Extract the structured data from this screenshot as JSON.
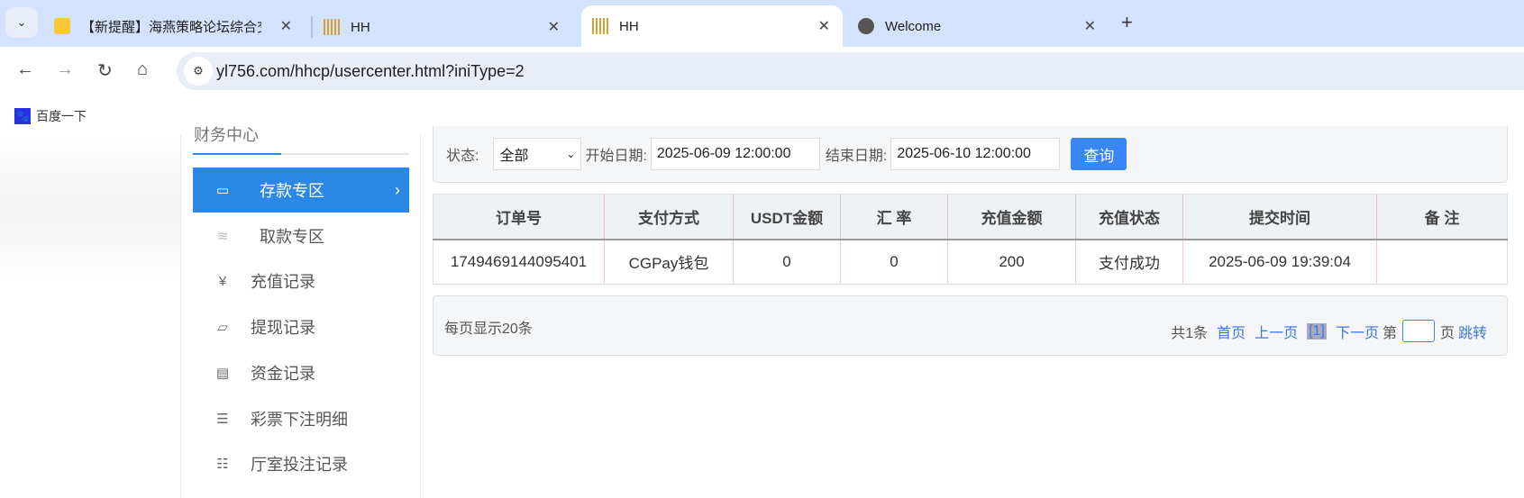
{
  "browser": {
    "tabs": [
      {
        "title": "【新提醒】海燕策略论坛综合交",
        "icon": "notification-icon",
        "active": false
      },
      {
        "title": "HH",
        "icon": "hh-logo-icon",
        "active": false
      },
      {
        "title": "HH",
        "icon": "hh-logo-icon",
        "active": true
      },
      {
        "title": "Welcome",
        "icon": "globe-icon",
        "active": false
      }
    ],
    "url": "yl756.com/hhcp/usercenter.html?iniType=2",
    "bookmarks": [
      {
        "label": "百度一下",
        "icon": "baidu-paw-icon"
      }
    ]
  },
  "sidebar": {
    "heading": "财务中心",
    "items": [
      {
        "label": "存款专区",
        "icon": "card-icon",
        "active": true
      },
      {
        "label": "取款专区",
        "icon": "hand-money-icon"
      },
      {
        "label": "充值记录",
        "icon": "money-bag-icon"
      },
      {
        "label": "提现记录",
        "icon": "wallet-icon"
      },
      {
        "label": "资金记录",
        "icon": "cash-icon"
      },
      {
        "label": "彩票下注明细",
        "icon": "list-card-icon"
      },
      {
        "label": "厅室投注记录",
        "icon": "list-icon"
      }
    ]
  },
  "filter": {
    "status_label": "状态:",
    "status_value": "全部",
    "start_label": "开始日期:",
    "start_value": "2025-06-09 12:00:00",
    "end_label": "结束日期:",
    "end_value": "2025-06-10 12:00:00",
    "query_button": "查询"
  },
  "table": {
    "headers": [
      "订单号",
      "支付方式",
      "USDT金额",
      "汇 率",
      "充值金额",
      "充值状态",
      "提交时间",
      "备 注"
    ],
    "rows": [
      [
        "1749469144095401",
        "CGPay钱包",
        "0",
        "0",
        "200",
        "支付成功",
        "2025-06-09 19:39:04",
        ""
      ]
    ]
  },
  "pager": {
    "per_page": "每页显示20条",
    "total": "共1条",
    "first": "首页",
    "prev": "上一页",
    "current": "[1]",
    "next": "下一页",
    "page_prefix": "第",
    "page_suffix": "页",
    "jump": "跳转"
  },
  "colors": {
    "accent": "#2b88e4",
    "button": "#3b86f6",
    "tabbar": "#d3e3fd"
  }
}
